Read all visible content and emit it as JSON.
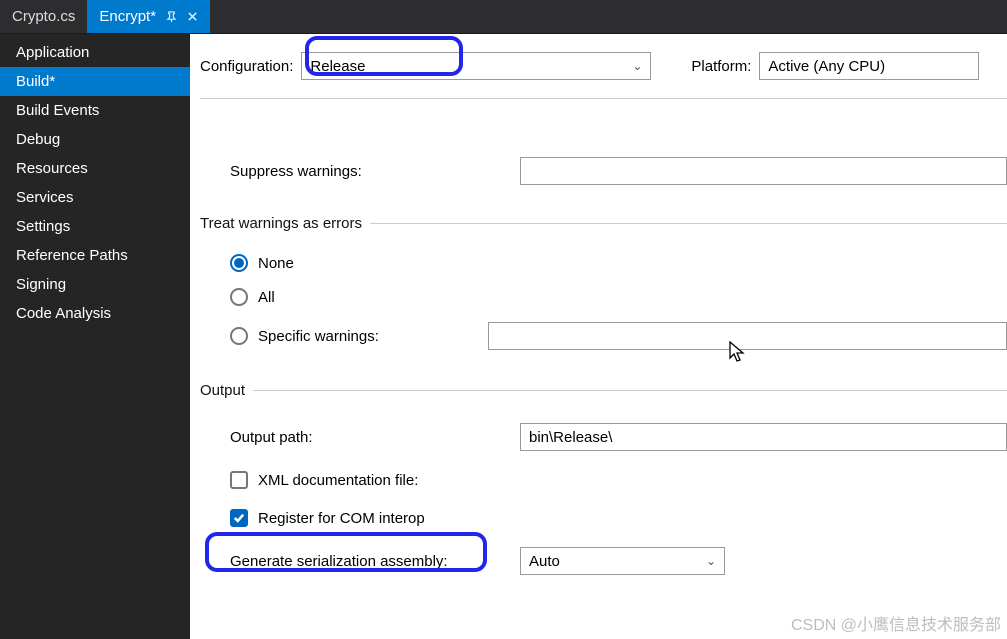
{
  "tabs": [
    {
      "label": "Crypto.cs",
      "active": false
    },
    {
      "label": "Encrypt*",
      "active": true
    }
  ],
  "sidebar": {
    "items": [
      "Application",
      "Build*",
      "Build Events",
      "Debug",
      "Resources",
      "Services",
      "Settings",
      "Reference Paths",
      "Signing",
      "Code Analysis"
    ],
    "selectedIndex": 1
  },
  "toprow": {
    "config_label": "Configuration:",
    "config_value": "Release",
    "platform_label": "Platform:",
    "platform_value": "Active (Any CPU)"
  },
  "suppress": {
    "label": "Suppress warnings:",
    "value": ""
  },
  "treat": {
    "group": "Treat warnings as errors",
    "none": "None",
    "all": "All",
    "specific": "Specific warnings:",
    "selected": "None",
    "specific_value": ""
  },
  "output": {
    "group": "Output",
    "path_label": "Output path:",
    "path_value": "bin\\Release\\",
    "xml_label": "XML documentation file:",
    "xml_checked": false,
    "com_label": "Register for COM interop",
    "com_checked": true,
    "ser_label": "Generate serialization assembly:",
    "ser_value": "Auto"
  },
  "watermark": "CSDN @小鹰信息技术服务部"
}
